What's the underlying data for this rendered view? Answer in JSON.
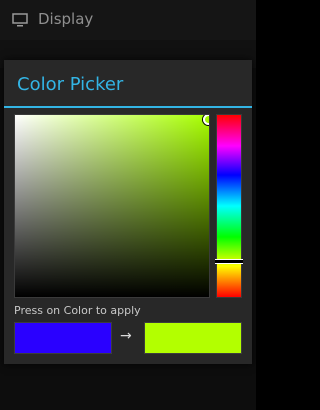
{
  "status_bar": {
    "title": "Display",
    "icon": "display-icon"
  },
  "dialog": {
    "title": "Color Picker",
    "accent_color": "#33b5e5",
    "picker": {
      "hue_color": "#a8ff00",
      "hue_fraction": 0.79,
      "saturation": 1.0,
      "value": 1.0
    },
    "hint": "Press on Color to apply",
    "old_color": "#2a00ff",
    "new_color": "#b3ff00",
    "arrow": "→"
  }
}
